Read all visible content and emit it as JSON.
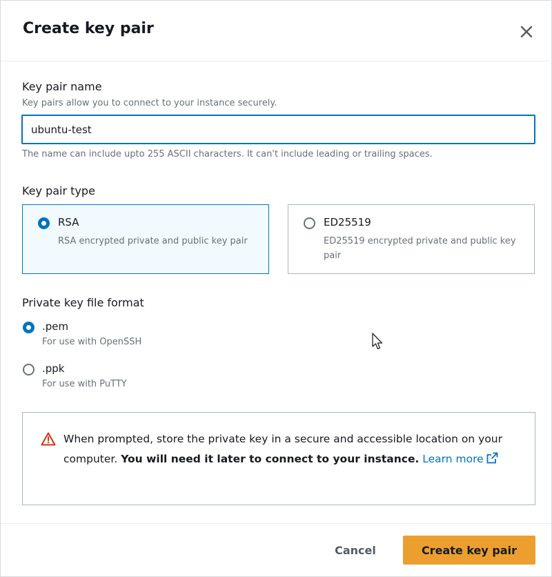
{
  "dialog": {
    "title": "Create key pair"
  },
  "name_field": {
    "label": "Key pair name",
    "description": "Key pairs allow you to connect to your instance securely.",
    "value": "ubuntu-test",
    "constraint": "The name can include upto 255 ASCII characters. It can't include leading or trailing spaces."
  },
  "key_type": {
    "label": "Key pair type",
    "options": [
      {
        "title": "RSA",
        "description": "RSA encrypted private and public key pair",
        "selected": true
      },
      {
        "title": "ED25519",
        "description": "ED25519 encrypted private and public key pair",
        "selected": false
      }
    ]
  },
  "file_format": {
    "label": "Private key file format",
    "options": [
      {
        "title": ".pem",
        "description": "For use with OpenSSH",
        "selected": true
      },
      {
        "title": ".ppk",
        "description": "For use with PuTTY",
        "selected": false
      }
    ]
  },
  "alert": {
    "icon": "warning-icon",
    "text_before": "When prompted, store the private key in a secure and accessible location on your computer. ",
    "text_bold": "You will need it later to connect to your instance.",
    "link_text": "Learn more",
    "link_icon": "external-link-icon"
  },
  "footer": {
    "cancel_label": "Cancel",
    "submit_label": "Create key pair"
  },
  "colors": {
    "accent": "#0073bb",
    "primary_button": "#ec9f2f",
    "selected_tile_bg": "#f1faff",
    "warning": "#d13212"
  }
}
